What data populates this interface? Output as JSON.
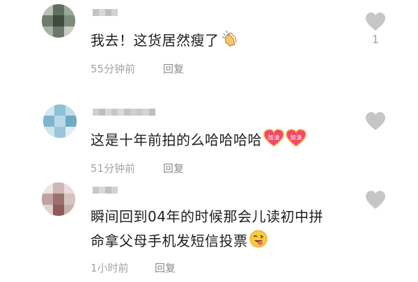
{
  "comments": [
    {
      "text": "我去！这货居然瘦了",
      "emoji": "clapping-hands",
      "time": "55分钟前",
      "reply": "回复",
      "likes": "1"
    },
    {
      "text": "这是十年前拍的么哈哈哈哈",
      "emoji": "cheer-up-hearts",
      "emoji_text": [
        "加油",
        "加油"
      ],
      "time": "51分钟前",
      "reply": "回复",
      "likes": ""
    },
    {
      "text_lines": [
        "瞬间回到04年的时候那会儿读初中拼",
        "命拿父母手机发短信投票"
      ],
      "emoji": "winking-tongue-face",
      "time": "1小时前",
      "reply": "回复",
      "likes": ""
    }
  ],
  "colors": {
    "text": "#1e1e1e",
    "meta": "#a3a3a3",
    "heart": "#c6c6c6",
    "cheer_heart": "#f2486a"
  },
  "icons": [
    "heart-icon",
    "clapping-hands-emoji",
    "cheer-heart-emoji",
    "winking-tongue-emoji"
  ]
}
